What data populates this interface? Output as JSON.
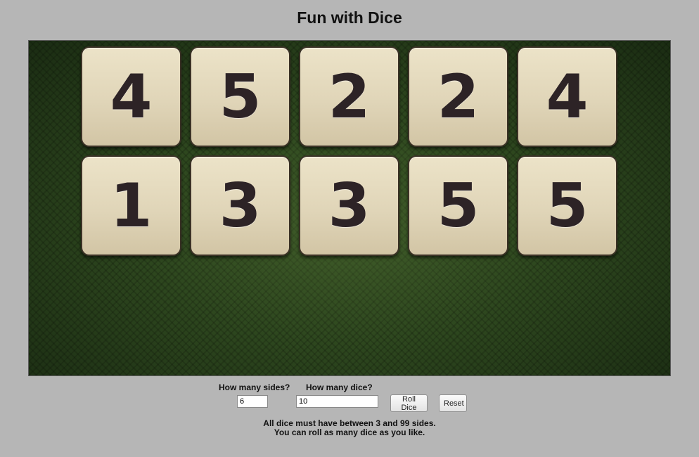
{
  "title": "Fun with Dice",
  "dice": [
    {
      "value": "4"
    },
    {
      "value": "5"
    },
    {
      "value": "2"
    },
    {
      "value": "2"
    },
    {
      "value": "4"
    },
    {
      "value": "1"
    },
    {
      "value": "3"
    },
    {
      "value": "3"
    },
    {
      "value": "5"
    },
    {
      "value": "5"
    }
  ],
  "controls": {
    "sides_label": "How many sides?",
    "sides_value": "6",
    "count_label": "How many dice?",
    "count_value": "10",
    "roll_label": "Roll Dice",
    "reset_label": "Reset"
  },
  "notes": {
    "line1": "All dice must have between 3 and 99 sides.",
    "line2": "You can roll as many dice as you like."
  },
  "colors": {
    "page_background": "#b6b6b6",
    "table_felt": "#2f4a20",
    "die_face": "#e0d5b8",
    "die_pips": "#2d2326"
  }
}
